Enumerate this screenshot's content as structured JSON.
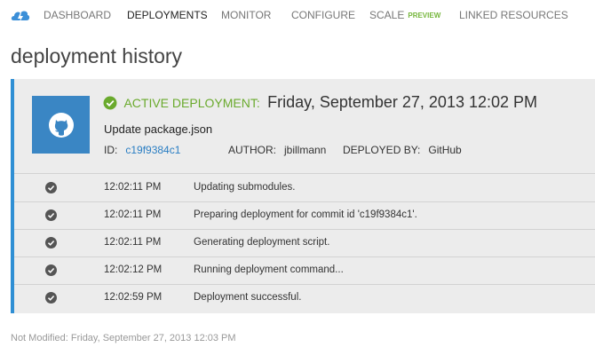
{
  "nav": {
    "logo_icon": "azure-cloud-icon",
    "items": [
      {
        "label": "DASHBOARD",
        "active": false
      },
      {
        "label": "DEPLOYMENTS",
        "active": true
      },
      {
        "label": "MONITOR",
        "active": false
      },
      {
        "label": "CONFIGURE",
        "active": false
      },
      {
        "label": "SCALE",
        "badge": "PREVIEW",
        "active": false
      },
      {
        "label": "LINKED RESOURCES",
        "active": false
      }
    ]
  },
  "page": {
    "title": "deployment history"
  },
  "deployment": {
    "avatar_icon": "github-octocat-icon",
    "status_label": "ACTIVE DEPLOYMENT:",
    "date": "Friday, September 27, 2013 12:02 PM",
    "message": "Update package.json",
    "id_label": "ID:",
    "id_value": "c19f9384c1",
    "author_label": "AUTHOR:",
    "author_value": "jbillmann",
    "deployed_by_label": "DEPLOYED BY:",
    "deployed_by_value": "GitHub"
  },
  "log": [
    {
      "time": "12:02:11 PM",
      "message": "Updating submodules."
    },
    {
      "time": "12:02:11 PM",
      "message": "Preparing deployment for commit id 'c19f9384c1'."
    },
    {
      "time": "12:02:11 PM",
      "message": "Generating deployment script."
    },
    {
      "time": "12:02:12 PM",
      "message": "Running deployment command..."
    },
    {
      "time": "12:02:59 PM",
      "message": "Deployment successful."
    }
  ],
  "footer": {
    "text": "Not Modified: Friday, September 27, 2013 12:03 PM"
  },
  "colors": {
    "accent": "#2f8fd4",
    "success": "#6aaa2d",
    "link": "#2a7ec3",
    "avatar_bg": "#3a86c4"
  }
}
